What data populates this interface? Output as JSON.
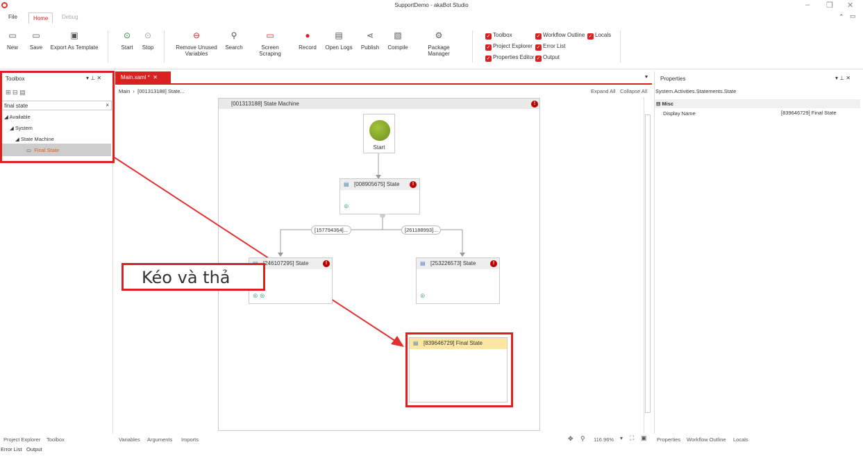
{
  "window": {
    "title": "SupportDemo - akaBot Studio"
  },
  "menu_tabs": [
    "File",
    "Home",
    "Debug"
  ],
  "ribbon": {
    "buttons": [
      "New",
      "Save",
      "Export As Template",
      "Start",
      "Stop",
      "Remove Unused Variables",
      "Search",
      "Screen Scraping",
      "Record",
      "Open Logs",
      "Publish",
      "Compile",
      "Package Manager"
    ],
    "checks": [
      "Toolbox",
      "Workflow Outline",
      "Locals",
      "Project Explorer",
      "Error List",
      "Properties Editor",
      "Output"
    ]
  },
  "toolbox": {
    "title": "Toolbox",
    "search_value": "final state",
    "tree": [
      "Available",
      "System",
      "State Machine",
      "Final State"
    ]
  },
  "document": {
    "tab": "Main.xaml *",
    "breadcrumb_main": "Main",
    "breadcrumb_item": "[001313188] State...",
    "expand_all": "Expand All",
    "collapse_all": "Collapse All"
  },
  "canvas": {
    "state_machine": "[001313188] State Machine",
    "start": "Start",
    "state1": "[008905675] State",
    "state2": "[246107295] State",
    "state3": "[253226573] State",
    "final": "[839646729] Final State",
    "trans1": "[157794364]...",
    "trans2": "[261188993]...",
    "annotation": "Kéo và thả"
  },
  "properties": {
    "title": "Properties",
    "type": "System.Activities.Statements.State",
    "category": "Misc",
    "prop_name": "Display Name",
    "prop_value": "[839646729] Final State"
  },
  "zoom": "116.96%",
  "bottom": {
    "left_tabs": [
      "Project Explorer",
      "Toolbox"
    ],
    "doc_tabs": [
      "Variables",
      "Arguments",
      "Imports"
    ],
    "right_tabs": [
      "Properties",
      "Workflow Outline",
      "Locals"
    ],
    "bottom_tabs": [
      "Error List",
      "Output"
    ]
  }
}
